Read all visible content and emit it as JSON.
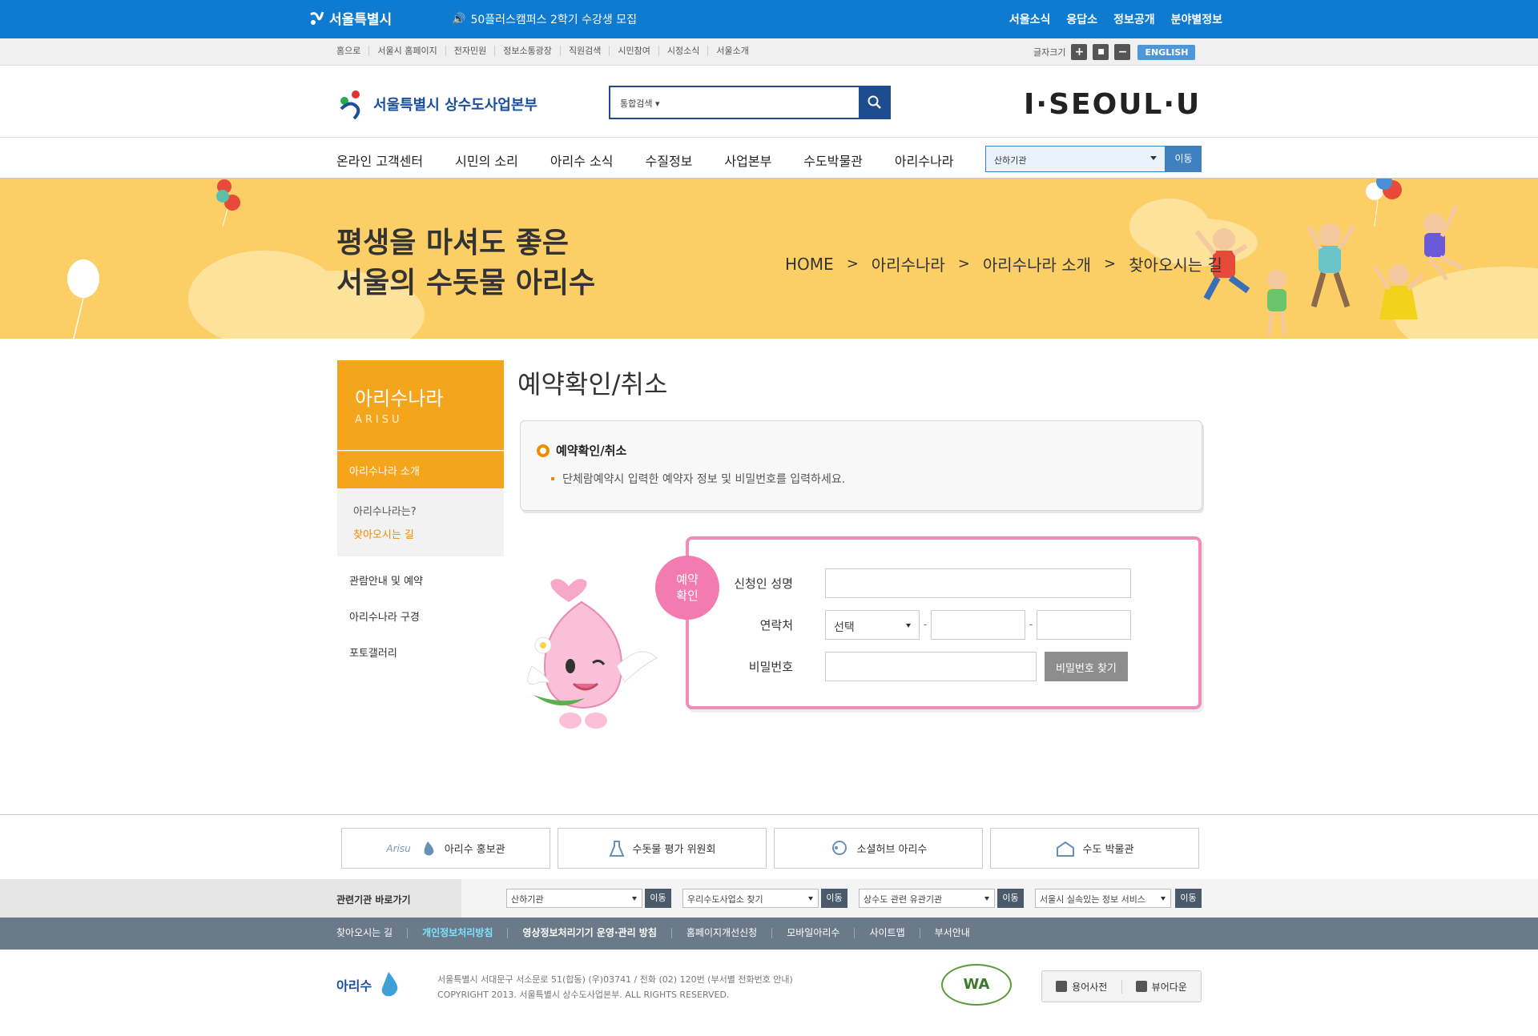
{
  "topbar": {
    "logo": "서울특별시",
    "notice": "50플러스캠퍼스 2학기 수강생 모집",
    "links": [
      "서울소식",
      "응답소",
      "정보공개",
      "분야별정보"
    ]
  },
  "util": {
    "links": [
      "홈으로",
      "서울시 홈페이지",
      "전자민원",
      "정보소통광장",
      "직원검색",
      "시민참여",
      "시정소식",
      "서울소개"
    ],
    "fontsize_label": "글자크기",
    "plus": "+",
    "reset": "■",
    "minus": "−",
    "english": "ENGLISH"
  },
  "header": {
    "site_title": "서울특별시 상수도사업본부",
    "search_scope": "통합검색",
    "brand": "I·SEOUL·U"
  },
  "gnb": {
    "menu": [
      "온라인 고객센터",
      "시민의 소리",
      "아리수 소식",
      "수질정보",
      "사업본부",
      "수도박물관",
      "아리수나라"
    ],
    "select_value": "산하기관",
    "go": "이동"
  },
  "banner": {
    "slogan_line1": "평생을 마셔도 좋은",
    "slogan_line2": "서울의 수돗물 아리수",
    "breadcrumb": [
      "HOME",
      "아리수나라",
      "아리수나라 소개",
      "찾아오시는 길"
    ]
  },
  "lnb": {
    "title": "아리수나라",
    "subtitle": "ARISU",
    "selected": "아리수나라 소개",
    "sub_items": [
      "아리수나라는?",
      "찾아오시는 길"
    ],
    "items": [
      "관람안내 및 예약",
      "아리수나라 구경",
      "포토갤러리"
    ]
  },
  "content": {
    "page_title": "예약확인/취소",
    "info_heading": "예약확인/취소",
    "info_desc": "단체람예약시 입력한 예약자 정보 및 비밀번호를 입력하세요.",
    "badge_line1": "예약",
    "badge_line2": "확인",
    "form": {
      "name_label": "신청인 성명",
      "phone_label": "연락처",
      "phone_select": "선택",
      "dash": "-",
      "pw_label": "비밀번호",
      "find_pw": "비밀번호 찾기"
    }
  },
  "footer": {
    "banners": [
      "아리수 홍보관",
      "수돗물 평가 위원회",
      "소셜허브 아리수",
      "수도 박물관"
    ],
    "arisu_small": "Arisu",
    "related_title": "관련기관 바로가기",
    "related": [
      {
        "value": "산하기관",
        "go": "이동"
      },
      {
        "value": "우리수도사업소 찾기",
        "go": "이동"
      },
      {
        "value": "상수도 관련 유관기관",
        "go": "이동"
      },
      {
        "value": "서울시 실속있는 정보 서비스",
        "go": "이동"
      }
    ],
    "links": [
      "찾아오시는 길",
      "개인정보처리방침",
      "영상정보처리기기 운영·관리 방침",
      "홈페이지개선신청",
      "모바일아리수",
      "사이트맵",
      "부서안내"
    ],
    "logo": "아리수",
    "address": "서울특별시 서대문구 서소문로 51(합동) (우)03741 / 전화 (02) 120번 (부서별 전화번호 안내)",
    "copyright": "COPYRIGHT 2013. 서울특별시 상수도사업본부. ALL RIGHTS RESERVED.",
    "wa_mark": "WA",
    "tools": [
      "용어사전",
      "뷰어다운"
    ]
  }
}
